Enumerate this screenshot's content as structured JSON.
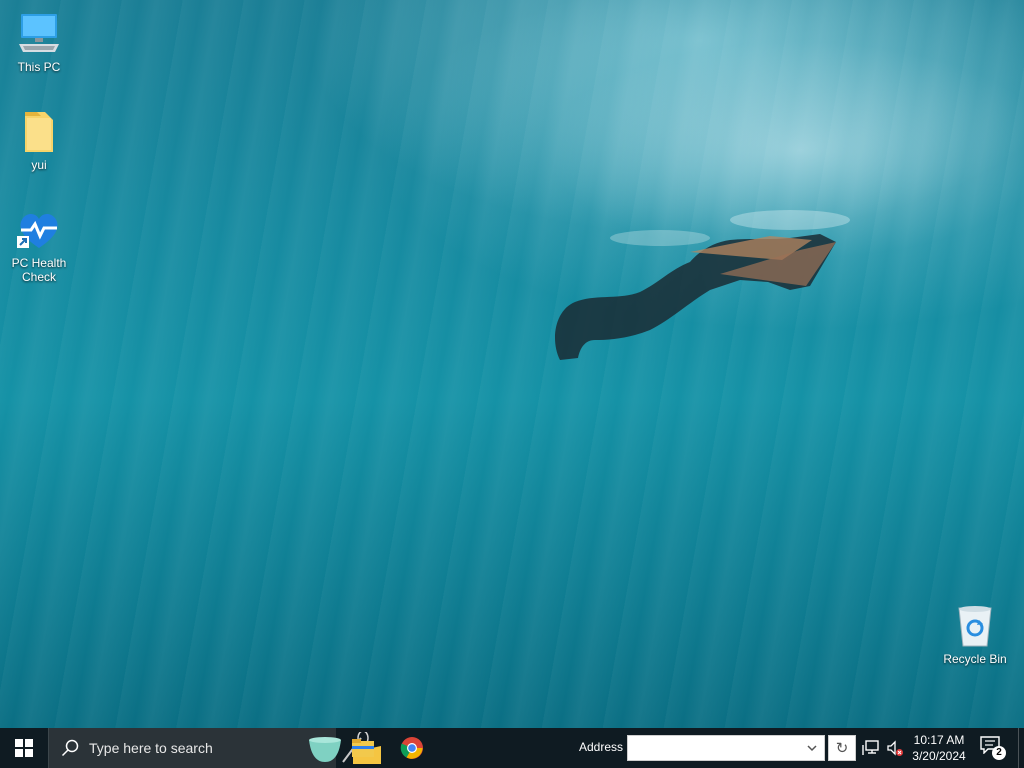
{
  "desktop": {
    "icons": [
      {
        "label": "This PC",
        "icon": "computer-icon"
      },
      {
        "label": "yui",
        "icon": "folder-icon"
      },
      {
        "label": "PC Health Check",
        "icon": "health-heart-icon"
      },
      {
        "label": "Recycle Bin",
        "icon": "recycle-bin-icon"
      }
    ]
  },
  "taskbar": {
    "start_icon": "windows-logo-icon",
    "search_placeholder": "Type here to search",
    "apps": [
      {
        "name": "File Explorer",
        "icon": "file-explorer-icon"
      },
      {
        "name": "Google Chrome",
        "icon": "chrome-icon"
      }
    ],
    "address_label": "Address",
    "address_value": "",
    "tray": {
      "network_icon": "network-icon",
      "volume_icon": "volume-muted-icon",
      "time": "10:17 AM",
      "date": "3/20/2024",
      "notification_count": "2"
    }
  },
  "colors": {
    "taskbar_bg": "#0f1b22",
    "search_bg": "#2b3338",
    "wallpaper_main": "#1592a6"
  }
}
